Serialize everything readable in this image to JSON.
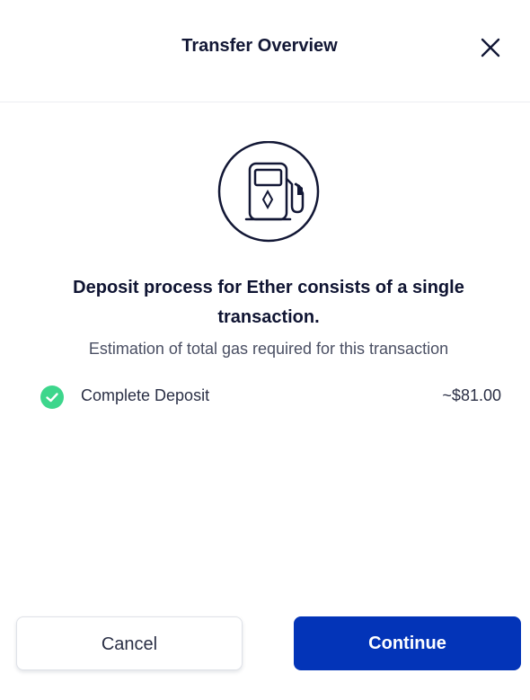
{
  "header": {
    "title": "Transfer Overview",
    "close_icon": "close-icon"
  },
  "hero": {
    "icon": "gas-pump-icon"
  },
  "content": {
    "headline": "Deposit process for Ether consists of a single transaction.",
    "subtext": "Estimation of total gas required for this transaction"
  },
  "steps": [
    {
      "label": "Complete Deposit",
      "value": "~$81.00",
      "status": "complete",
      "status_color": "#3dd68c"
    }
  ],
  "actions": {
    "cancel_label": "Cancel",
    "continue_label": "Continue"
  },
  "colors": {
    "primary": "#0334b8",
    "text": "#0f1432",
    "success": "#3dd68c"
  }
}
